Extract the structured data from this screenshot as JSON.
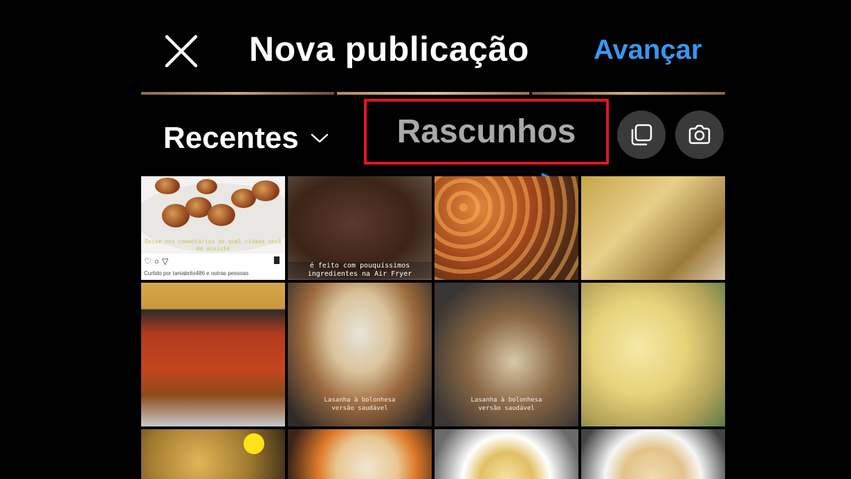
{
  "header": {
    "close_icon": "close-icon",
    "title": "Nova publicação",
    "next_label": "Avançar",
    "accent_color": "#3897f0"
  },
  "album": {
    "label": "Recentes",
    "dropdown_icon": "chevron-down-icon"
  },
  "drafts": {
    "label": "Rascunhos",
    "highlight_color": "#e5141e"
  },
  "actions": {
    "multi_select_icon": "multi-select-icon",
    "camera_icon": "camera-icon"
  },
  "gallery": {
    "tiles": [
      {
        "caption": "Deixe nos comentários de qual cidade você me assiste",
        "liked_by": "Curtido por taniabrito486 e outras pessoas"
      },
      {
        "caption": "é feito com pouquíssimos ingredientes na Air Fryer"
      },
      {
        "caption": ""
      },
      {
        "caption": ""
      },
      {
        "caption": ""
      },
      {
        "caption": "Lasanha à bolonhesa",
        "subcaption": "versão saudável"
      },
      {
        "caption": "Lasanha à bolonhesa",
        "subcaption": "versão saudável"
      },
      {
        "caption": ""
      },
      {
        "caption": ""
      },
      {
        "caption": ""
      },
      {
        "caption": ""
      },
      {
        "caption": ""
      }
    ]
  }
}
